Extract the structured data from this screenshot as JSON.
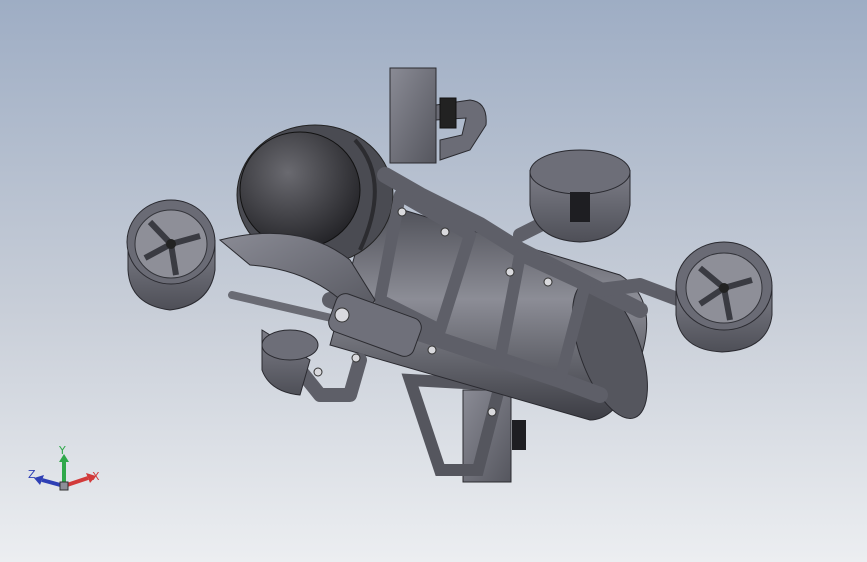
{
  "viewport": {
    "background_top": "#9eadc4",
    "background_bottom": "#eceef1"
  },
  "model": {
    "icon": "rov-model-icon",
    "body_color": "#5f6069",
    "frame_color": "#6e6f7a",
    "dome_color": "#3a3a3e"
  },
  "triad": {
    "x_label": "X",
    "y_label": "Y",
    "z_label": "Z",
    "x_color": "#d23a3a",
    "y_color": "#2fa84a",
    "z_color": "#2e3fb5"
  }
}
